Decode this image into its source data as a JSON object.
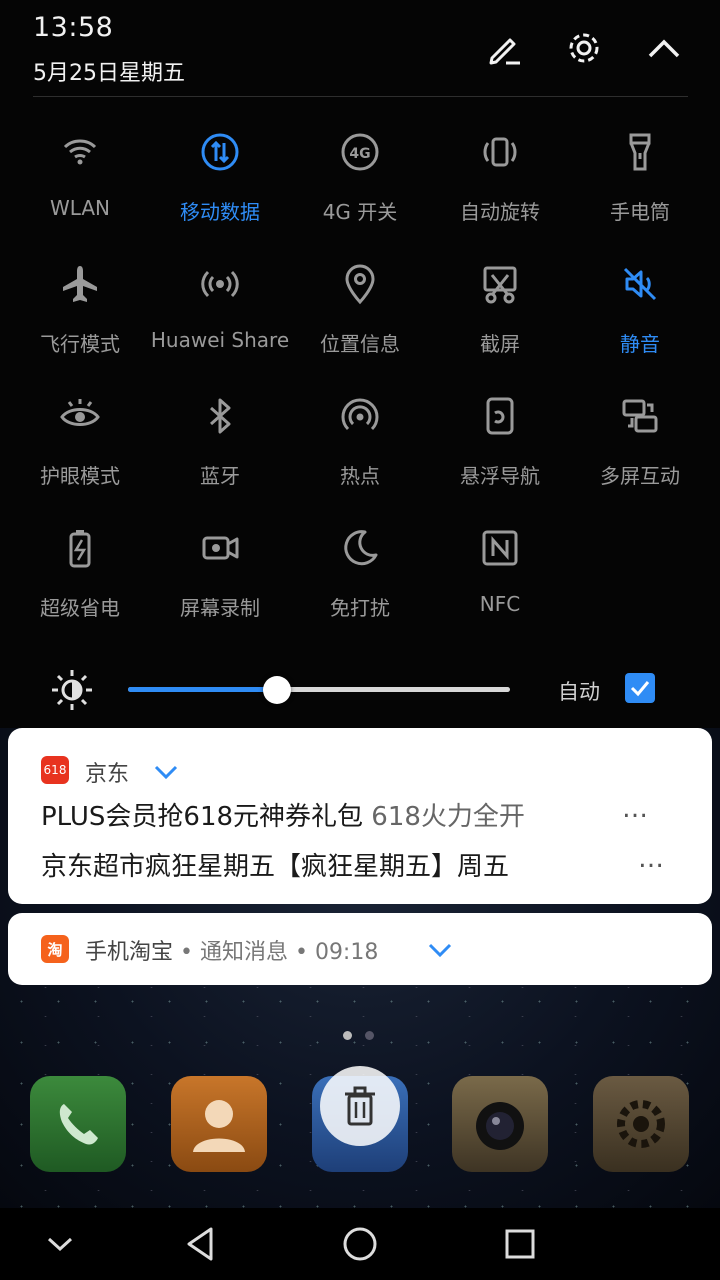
{
  "status": {
    "time": "13:58",
    "date": "5月25日星期五"
  },
  "header_icons": [
    "edit-icon",
    "settings-gear-icon",
    "collapse-chevron-up-icon"
  ],
  "colors": {
    "accent": "#2f8cf5",
    "inactive": "#9a9a9a",
    "background": "#050505"
  },
  "toggles": [
    {
      "label": "WLAN",
      "icon": "wifi-icon",
      "active": false
    },
    {
      "label": "移动数据",
      "icon": "mobile-data-icon",
      "active": true
    },
    {
      "label": "4G 开关",
      "icon": "4g-icon",
      "active": false
    },
    {
      "label": "自动旋转",
      "icon": "auto-rotate-icon",
      "active": false
    },
    {
      "label": "手电筒",
      "icon": "flashlight-icon",
      "active": false
    },
    {
      "label": "飞行模式",
      "icon": "airplane-icon",
      "active": false
    },
    {
      "label": "Huawei Share",
      "icon": "huawei-share-icon",
      "active": false
    },
    {
      "label": "位置信息",
      "icon": "location-icon",
      "active": false
    },
    {
      "label": "截屏",
      "icon": "screenshot-icon",
      "active": false
    },
    {
      "label": "静音",
      "icon": "mute-icon",
      "active": true
    },
    {
      "label": "护眼模式",
      "icon": "eye-comfort-icon",
      "active": false
    },
    {
      "label": "蓝牙",
      "icon": "bluetooth-icon",
      "active": false
    },
    {
      "label": "热点",
      "icon": "hotspot-icon",
      "active": false
    },
    {
      "label": "悬浮导航",
      "icon": "floating-nav-icon",
      "active": false
    },
    {
      "label": "多屏互动",
      "icon": "multi-screen-icon",
      "active": false
    },
    {
      "label": "超级省电",
      "icon": "battery-saver-icon",
      "active": false
    },
    {
      "label": "屏幕录制",
      "icon": "screen-record-icon",
      "active": false
    },
    {
      "label": "免打扰",
      "icon": "do-not-disturb-moon-icon",
      "active": false
    },
    {
      "label": "NFC",
      "icon": "nfc-icon",
      "active": false
    }
  ],
  "brightness": {
    "level": 0.39,
    "auto_label": "自动",
    "auto_checked": true
  },
  "notifications": [
    {
      "app": "京东",
      "app_icon_text": "618",
      "line1_title": "PLUS会员抢618元神券礼包",
      "line1_text": "618火力全开",
      "line2": "京东超市疯狂星期五【疯狂星期五】周五",
      "ellipsis": "…"
    },
    {
      "app": "手机淘宝",
      "app_icon_text": "淘",
      "meta": " • 通知消息 • 09:18"
    }
  ],
  "nav": [
    "collapse-down-icon",
    "back-icon",
    "home-icon",
    "recents-icon"
  ]
}
